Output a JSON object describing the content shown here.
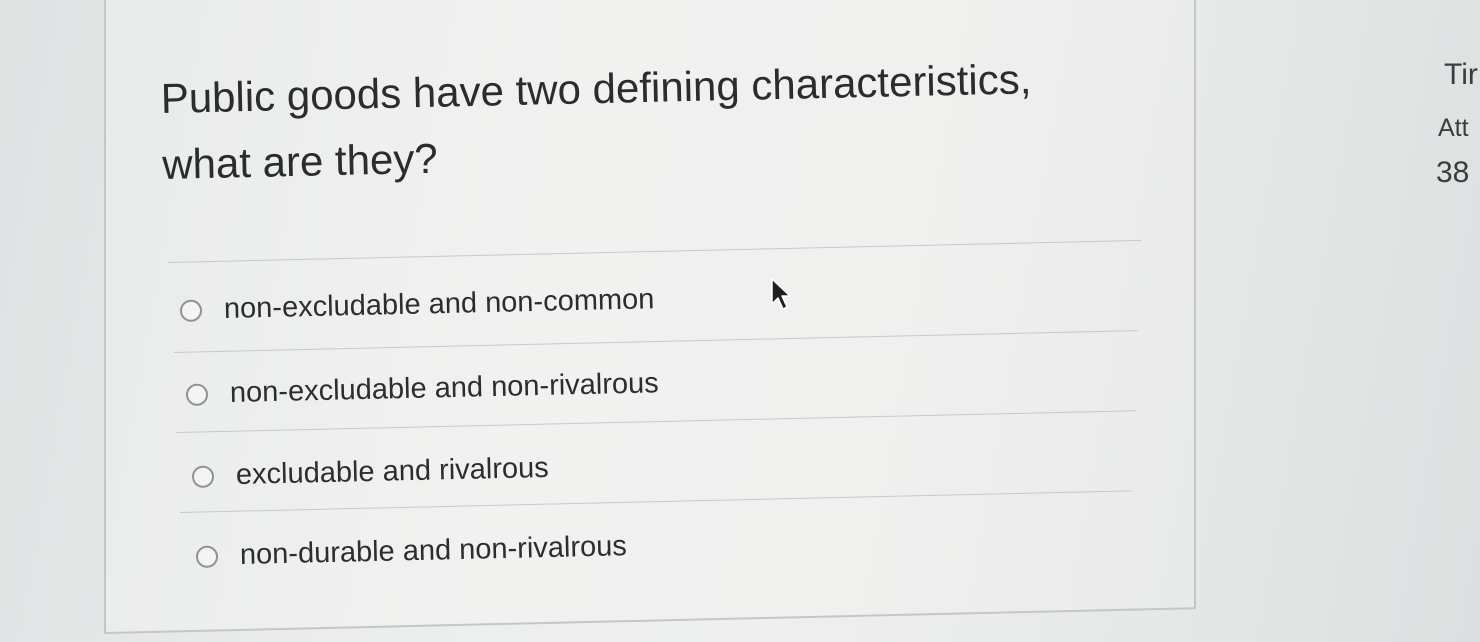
{
  "quiz": {
    "question": "Public goods have two defining characteristics, what are they?",
    "options": [
      {
        "label": "non-excludable and non-common"
      },
      {
        "label": "non-excludable and non-rivalrous"
      },
      {
        "label": "excludable and rivalrous"
      },
      {
        "label": "non-durable and non-rivalrous"
      }
    ]
  },
  "sidebar": {
    "time_label": "Tir",
    "attempt_label": "Att",
    "value": "38"
  },
  "icons": {
    "cursor": "mouse-pointer-icon",
    "radio": "radio-unselected-icon"
  }
}
